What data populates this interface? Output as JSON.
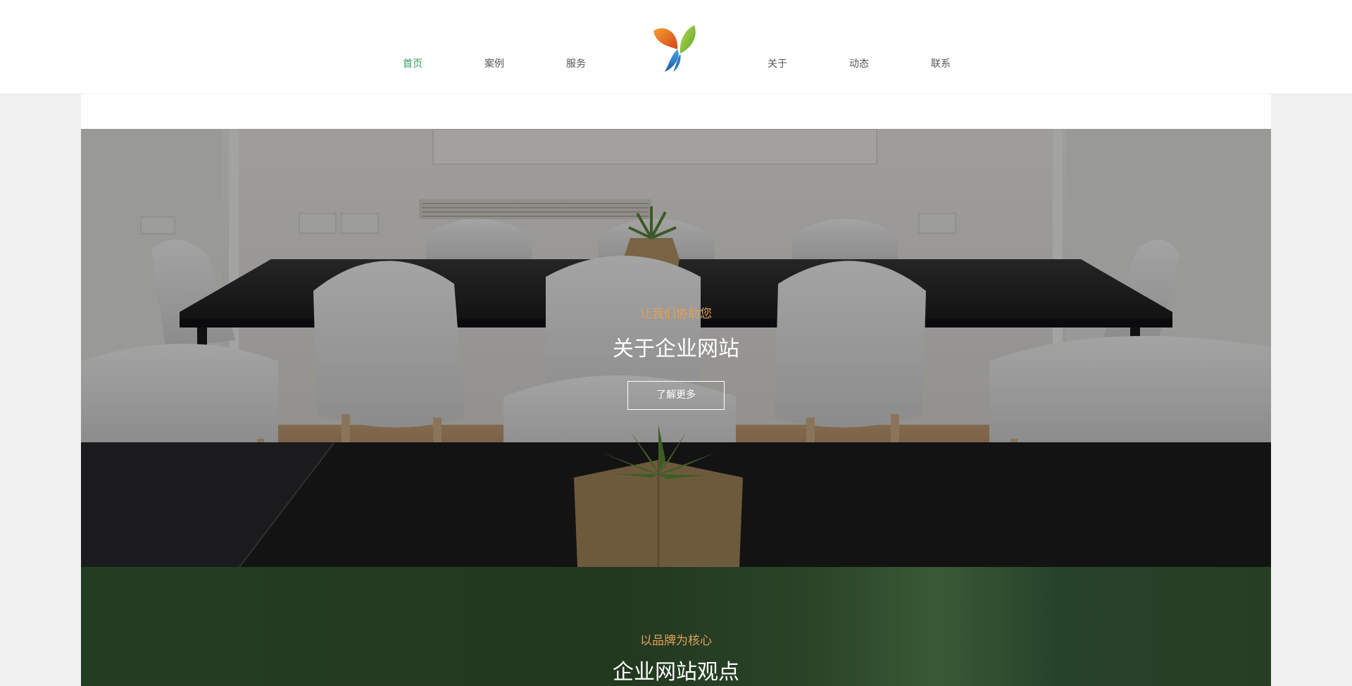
{
  "nav": {
    "left": [
      {
        "label": "首页",
        "active": true
      },
      {
        "label": "案例",
        "active": false
      },
      {
        "label": "服务",
        "active": false
      }
    ],
    "right": [
      {
        "label": "关于",
        "active": false
      },
      {
        "label": "动态",
        "active": false
      },
      {
        "label": "联系",
        "active": false
      }
    ],
    "logo_icon": "leaf-logo-icon",
    "active_color": "#2e9e5b"
  },
  "hero": {
    "kicker": "让我们协助您",
    "title": "关于企业网站",
    "button_label": "了解更多",
    "kicker_color": "#e0a05a"
  },
  "section2": {
    "kicker": "以品牌为核心",
    "title": "企业网站观点",
    "background_color": "#243d22"
  }
}
